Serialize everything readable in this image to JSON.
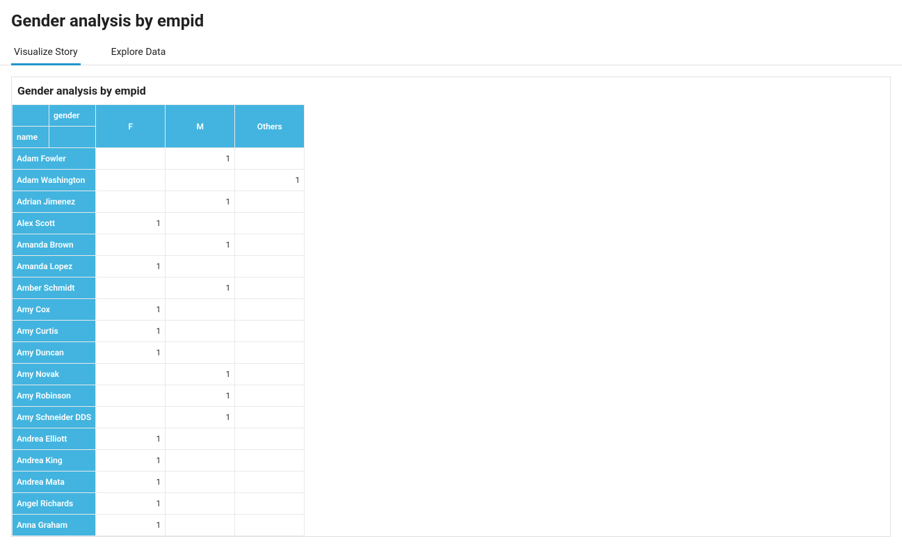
{
  "page_title": "Gender analysis by empid",
  "tabs": [
    {
      "label": "Visualize Story",
      "active": true
    },
    {
      "label": "Explore Data",
      "active": false
    }
  ],
  "card_title": "Gender analysis by empid",
  "pivot": {
    "col_dim_label": "gender",
    "row_dim_label": "name",
    "columns": [
      "F",
      "M",
      "Others"
    ],
    "rows": [
      {
        "name": "Adam Fowler",
        "F": "",
        "M": "1",
        "Others": ""
      },
      {
        "name": "Adam Washington",
        "F": "",
        "M": "",
        "Others": "1"
      },
      {
        "name": "Adrian Jimenez",
        "F": "",
        "M": "1",
        "Others": ""
      },
      {
        "name": "Alex Scott",
        "F": "1",
        "M": "",
        "Others": ""
      },
      {
        "name": "Amanda Brown",
        "F": "",
        "M": "1",
        "Others": ""
      },
      {
        "name": "Amanda Lopez",
        "F": "1",
        "M": "",
        "Others": ""
      },
      {
        "name": "Amber Schmidt",
        "F": "",
        "M": "1",
        "Others": ""
      },
      {
        "name": "Amy Cox",
        "F": "1",
        "M": "",
        "Others": ""
      },
      {
        "name": "Amy Curtis",
        "F": "1",
        "M": "",
        "Others": ""
      },
      {
        "name": "Amy Duncan",
        "F": "1",
        "M": "",
        "Others": ""
      },
      {
        "name": "Amy Novak",
        "F": "",
        "M": "1",
        "Others": ""
      },
      {
        "name": "Amy Robinson",
        "F": "",
        "M": "1",
        "Others": ""
      },
      {
        "name": "Amy Schneider DDS",
        "F": "",
        "M": "1",
        "Others": ""
      },
      {
        "name": "Andrea Elliott",
        "F": "1",
        "M": "",
        "Others": ""
      },
      {
        "name": "Andrea King",
        "F": "1",
        "M": "",
        "Others": ""
      },
      {
        "name": "Andrea Mata",
        "F": "1",
        "M": "",
        "Others": ""
      },
      {
        "name": "Angel Richards",
        "F": "1",
        "M": "",
        "Others": ""
      },
      {
        "name": "Anna Graham",
        "F": "1",
        "M": "",
        "Others": ""
      }
    ]
  }
}
